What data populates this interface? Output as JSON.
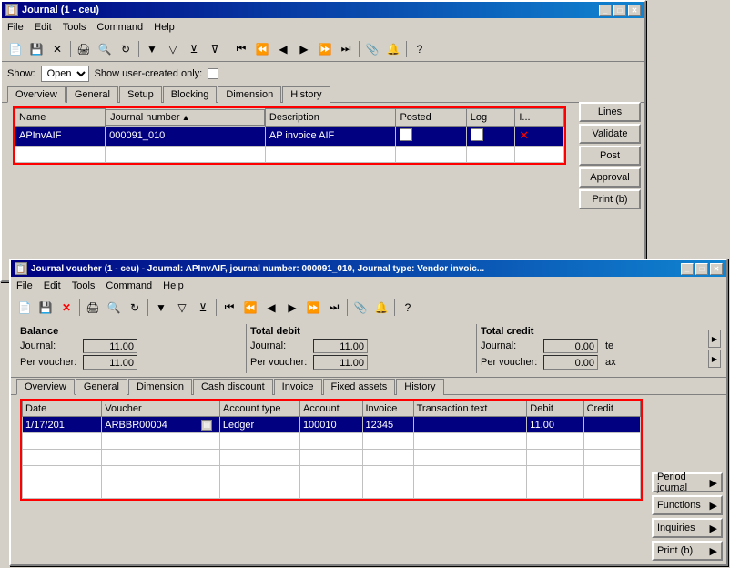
{
  "journal_window": {
    "title": "Journal (1 - ceu)",
    "menu": [
      "File",
      "Edit",
      "Tools",
      "Command",
      "Help"
    ],
    "show_label": "Show:",
    "show_value": "Open",
    "user_created_label": "Show user-created only:",
    "tabs": [
      "Overview",
      "General",
      "Setup",
      "Blocking",
      "Dimension",
      "History"
    ],
    "active_tab": "Overview",
    "table_headers": [
      "Name",
      "Journal number",
      "Description",
      "Posted",
      "Log",
      "I..."
    ],
    "table_row": {
      "name": "APInvAIF",
      "journal_number": "000091_010",
      "description": "AP invoice AIF",
      "posted": "",
      "log": "",
      "i": ""
    },
    "right_buttons": [
      "Lines",
      "Validate",
      "Post",
      "Approval",
      "Print (b)"
    ]
  },
  "voucher_window": {
    "title": "Journal voucher (1 - ceu) - Journal: APInvAIF, journal number: 000091_010, Journal type: Vendor invoic...",
    "menu": [
      "File",
      "Edit",
      "Tools",
      "Command",
      "Help"
    ],
    "balance_section": {
      "left": {
        "title": "Balance",
        "journal_label": "Journal:",
        "journal_value": "11.00",
        "voucher_label": "Per voucher:",
        "voucher_value": "11.00"
      },
      "center": {
        "title": "Total debit",
        "journal_label": "Journal:",
        "journal_value": "11.00",
        "voucher_label": "Per voucher:",
        "voucher_value": "11.00"
      },
      "right": {
        "title": "Total credit",
        "journal_label": "Journal:",
        "journal_value": "0.00",
        "voucher_label": "Per voucher:",
        "voucher_value": "0.00",
        "suffix1": "te",
        "suffix2": "ax"
      }
    },
    "tabs": [
      "Overview",
      "General",
      "Dimension",
      "Cash discount",
      "Invoice",
      "Fixed assets",
      "History"
    ],
    "active_tab": "Overview",
    "table_headers": [
      "Date",
      "Voucher",
      "",
      "Account type",
      "Account",
      "Invoice",
      "Transaction text",
      "Debit",
      "Credit"
    ],
    "table_row": {
      "date": "1/17/201",
      "voucher": "ARBBR00004",
      "icon": "",
      "account_type": "Ledger",
      "account": "100010",
      "invoice": "12345",
      "transaction_text": "",
      "debit": "11.00",
      "credit": ""
    },
    "right_buttons": [
      {
        "label": "Period journal",
        "arrow": "▶"
      },
      {
        "label": "Functions",
        "arrow": "▶"
      },
      {
        "label": "Inquiries",
        "arrow": "▶"
      },
      {
        "label": "Print (b)",
        "arrow": "▶"
      }
    ]
  }
}
